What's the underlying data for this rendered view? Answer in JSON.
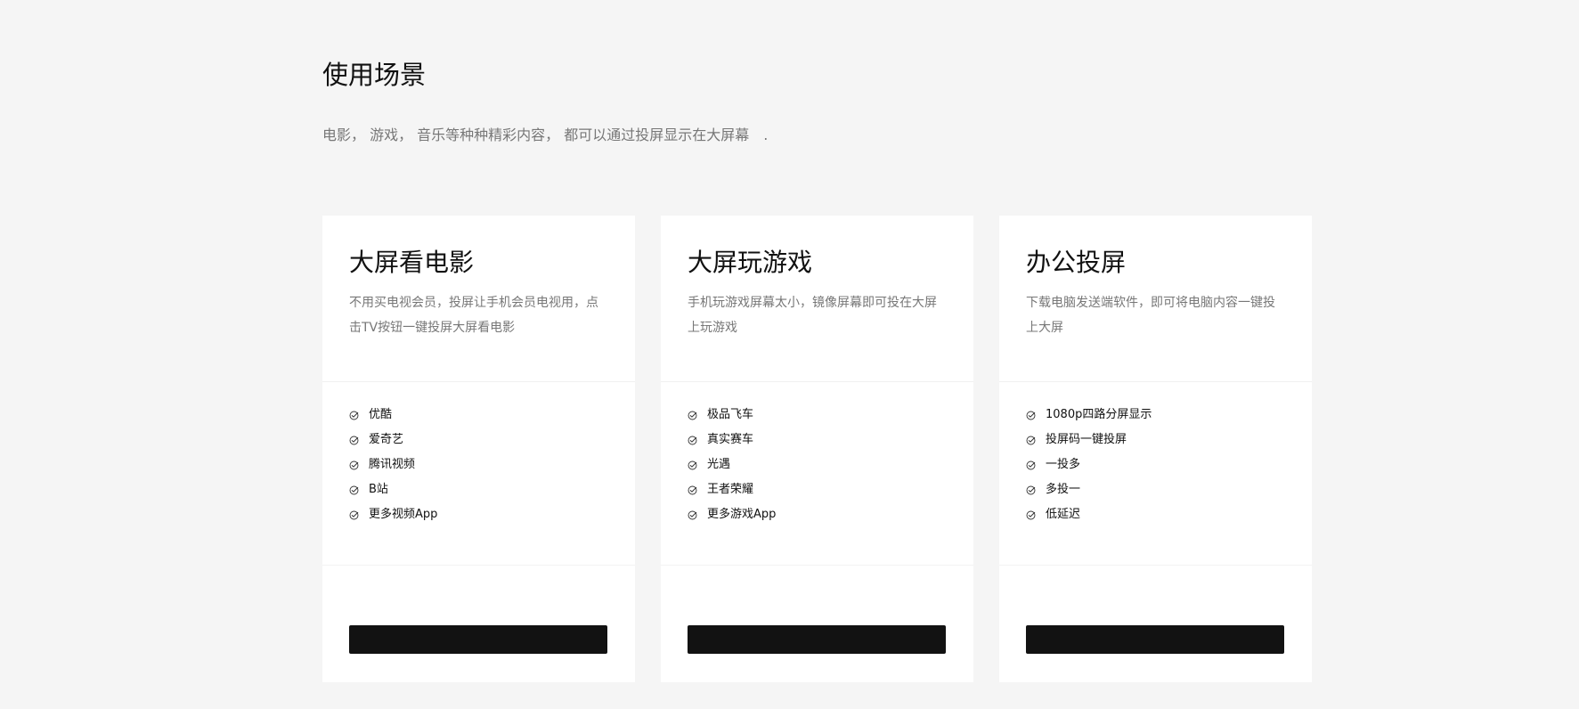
{
  "section": {
    "title": "使用场景",
    "subtitle": "电影， 游戏， 音乐等种种精彩内容， 都可以通过投屏显示在大屏幕　."
  },
  "cards": [
    {
      "title": "大屏看电影",
      "description": "不用买电视会员，投屏让手机会员电视用，点击TV按钮一键投屏大屏看电影",
      "features": [
        "优酷",
        "爱奇艺",
        "腾讯视频",
        "B站",
        "更多视频App"
      ],
      "button_label": ""
    },
    {
      "title": "大屏玩游戏",
      "description": "手机玩游戏屏幕太小，镜像屏幕即可投在大屏上玩游戏",
      "features": [
        "极品飞车",
        "真实赛车",
        "光遇",
        "王者荣耀",
        "更多游戏App"
      ],
      "button_label": ""
    },
    {
      "title": "办公投屏",
      "description": "下载电脑发送端软件，即可将电脑内容一键投上大屏",
      "features": [
        "1080p四路分屏显示",
        "投屏码一键投屏",
        "一投多",
        "多投一",
        "低延迟"
      ],
      "button_label": ""
    }
  ],
  "icons": {
    "feature_check": "circle-check-icon"
  },
  "colors": {
    "background": "#f5f5f5",
    "card": "#ffffff",
    "button": "#121212",
    "muted_text": "#777777"
  }
}
